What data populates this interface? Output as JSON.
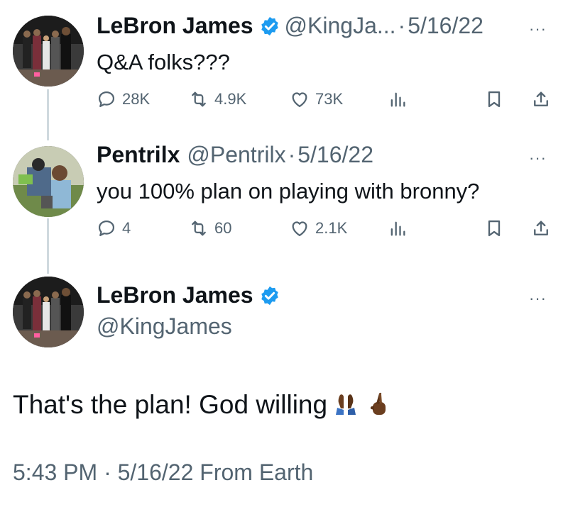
{
  "reply1": {
    "name": "LeBron James",
    "handle": "@KingJa...",
    "separator": "·",
    "date": "5/16/22",
    "more": "···",
    "text": "Q&A folks???",
    "replies": "28K",
    "retweets": "4.9K",
    "likes": "73K"
  },
  "reply2": {
    "name": "Pentrilx",
    "handle": "@Pentrilx",
    "separator": "·",
    "date": "5/16/22",
    "more": "···",
    "text": "you 100% plan on playing with bronny?",
    "replies": "4",
    "retweets": "60",
    "likes": "2.1K"
  },
  "main": {
    "name": "LeBron James",
    "handle": "@KingJames",
    "more": "···",
    "text": "That's the plan! God willing",
    "footer": "5:43 PM · 5/16/22 From Earth"
  },
  "colors": {
    "verified": "#1d9bf0",
    "muted": "#536471",
    "text": "#0f1419",
    "thread_line": "#cfd9de"
  },
  "icons": [
    "reply-icon",
    "retweet-icon",
    "like-icon",
    "views-icon",
    "bookmark-icon",
    "share-icon",
    "verified-badge-icon",
    "folded-hands-emoji",
    "crossed-fingers-emoji"
  ]
}
